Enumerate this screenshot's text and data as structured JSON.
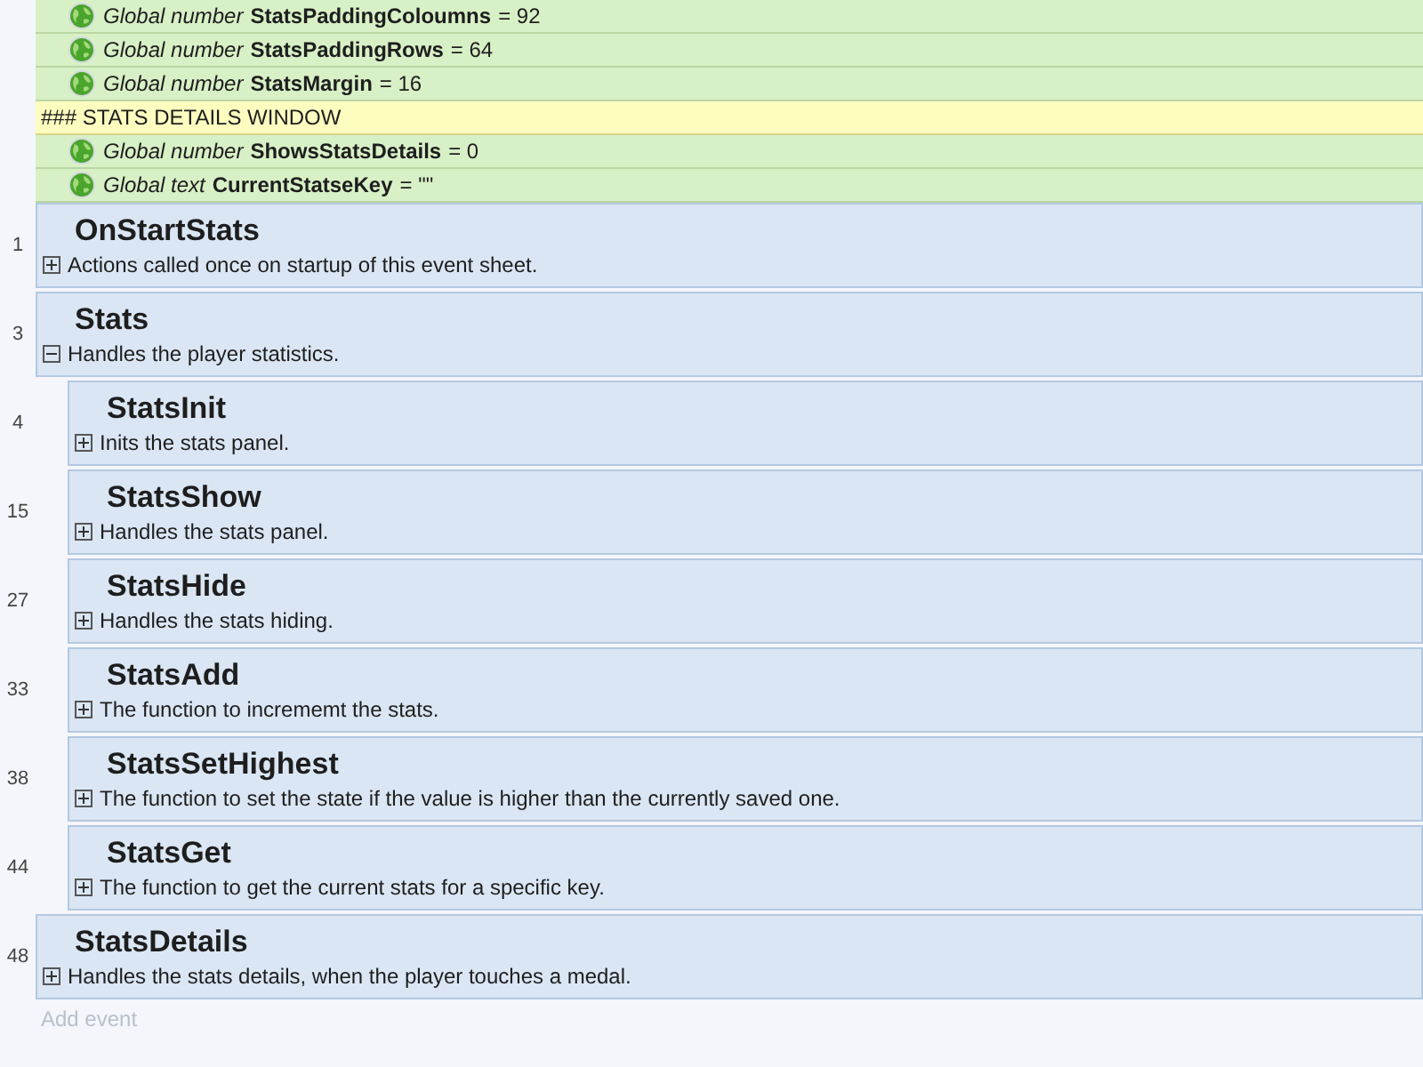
{
  "globals": [
    {
      "kind": "variable",
      "type": "Global number",
      "name": "StatsPaddingColoumns",
      "value": "= 92"
    },
    {
      "kind": "variable",
      "type": "Global number",
      "name": "StatsPaddingRows",
      "value": "= 64"
    },
    {
      "kind": "variable",
      "type": "Global number",
      "name": "StatsMargin",
      "value": "= 16"
    },
    {
      "kind": "comment",
      "text": "### STATS DETAILS WINDOW"
    },
    {
      "kind": "variable",
      "type": "Global number",
      "name": "ShowsStatsDetails",
      "value": "= 0"
    },
    {
      "kind": "variable",
      "type": "Global text",
      "name": "CurrentStatseKey",
      "value": "= \"\""
    }
  ],
  "events": [
    {
      "line": "1",
      "title": "OnStartStats",
      "description": "Actions called once on startup of this event sheet.",
      "expanded": false
    },
    {
      "line": "3",
      "title": "Stats",
      "description": "Handles the player statistics.",
      "expanded": true,
      "children": [
        {
          "line": "4",
          "title": "StatsInit",
          "description": "Inits the stats panel.",
          "expanded": false
        },
        {
          "line": "15",
          "title": "StatsShow",
          "description": "Handles the stats panel.",
          "expanded": false
        },
        {
          "line": "27",
          "title": "StatsHide",
          "description": "Handles the stats hiding.",
          "expanded": false
        },
        {
          "line": "33",
          "title": "StatsAdd",
          "description": "The function to incrememt the stats.",
          "expanded": false
        },
        {
          "line": "38",
          "title": "StatsSetHighest",
          "description": "The function to set the state if the value is higher than the currently saved one.",
          "expanded": false
        },
        {
          "line": "44",
          "title": "StatsGet",
          "description": "The function to get the current stats for a specific key.",
          "expanded": false
        }
      ]
    },
    {
      "line": "48",
      "title": "StatsDetails",
      "description": "Handles the stats details, when the player touches a medal.",
      "expanded": false
    }
  ],
  "add_event": "Add event"
}
